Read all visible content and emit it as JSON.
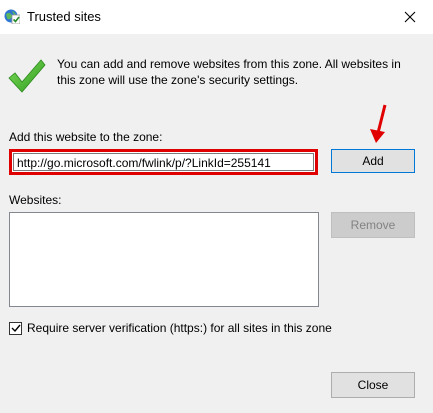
{
  "window": {
    "title": "Trusted sites",
    "icon": "globe-check-icon",
    "close_icon": "close-icon"
  },
  "info": {
    "icon": "green-check-icon",
    "message": "You can add and remove websites from this zone. All websites in this zone will use the zone's security settings."
  },
  "add_section": {
    "label": "Add this website to the zone:",
    "url_value": "http://go.microsoft.com/fwlink/p/?LinkId=255141",
    "add_button": "Add"
  },
  "websites_section": {
    "label": "Websites:",
    "items": [],
    "remove_button": "Remove"
  },
  "verification": {
    "checked": true,
    "label": "Require server verification (https:) for all sites in this zone"
  },
  "footer": {
    "close_button": "Close"
  },
  "colors": {
    "highlight_border": "#e00000",
    "annotation_arrow": "#e00000",
    "check_green": "#3cb521",
    "dialog_bg": "#f0f0f0"
  }
}
